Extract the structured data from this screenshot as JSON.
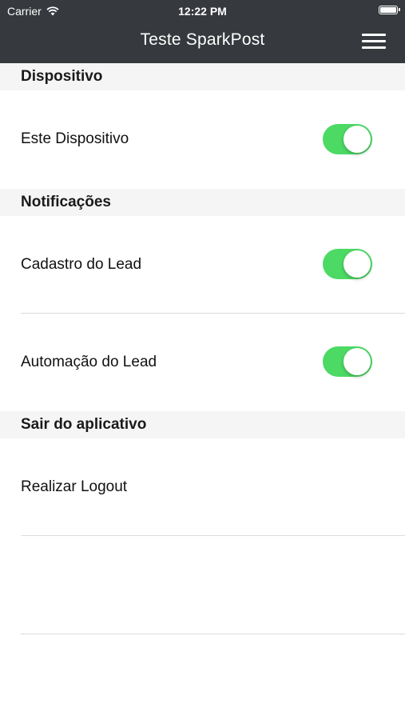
{
  "status_bar": {
    "carrier": "Carrier",
    "time": "12:22 PM"
  },
  "nav": {
    "title": "Teste SparkPost",
    "menu_icon": "hamburger-menu-icon"
  },
  "sections": {
    "device": {
      "header": "Dispositivo",
      "this_device": {
        "label": "Este Dispositivo",
        "enabled": true
      }
    },
    "notifications": {
      "header": "Notificações",
      "lead_registration": {
        "label": "Cadastro do Lead",
        "enabled": true
      },
      "lead_automation": {
        "label": "Automação do Lead",
        "enabled": true
      }
    },
    "exit": {
      "header": "Sair do aplicativo",
      "logout": {
        "label": "Realizar Logout"
      }
    }
  },
  "colors": {
    "nav_bg": "#36393d",
    "toggle_on": "#4cd964",
    "section_bg": "#f5f5f5"
  }
}
